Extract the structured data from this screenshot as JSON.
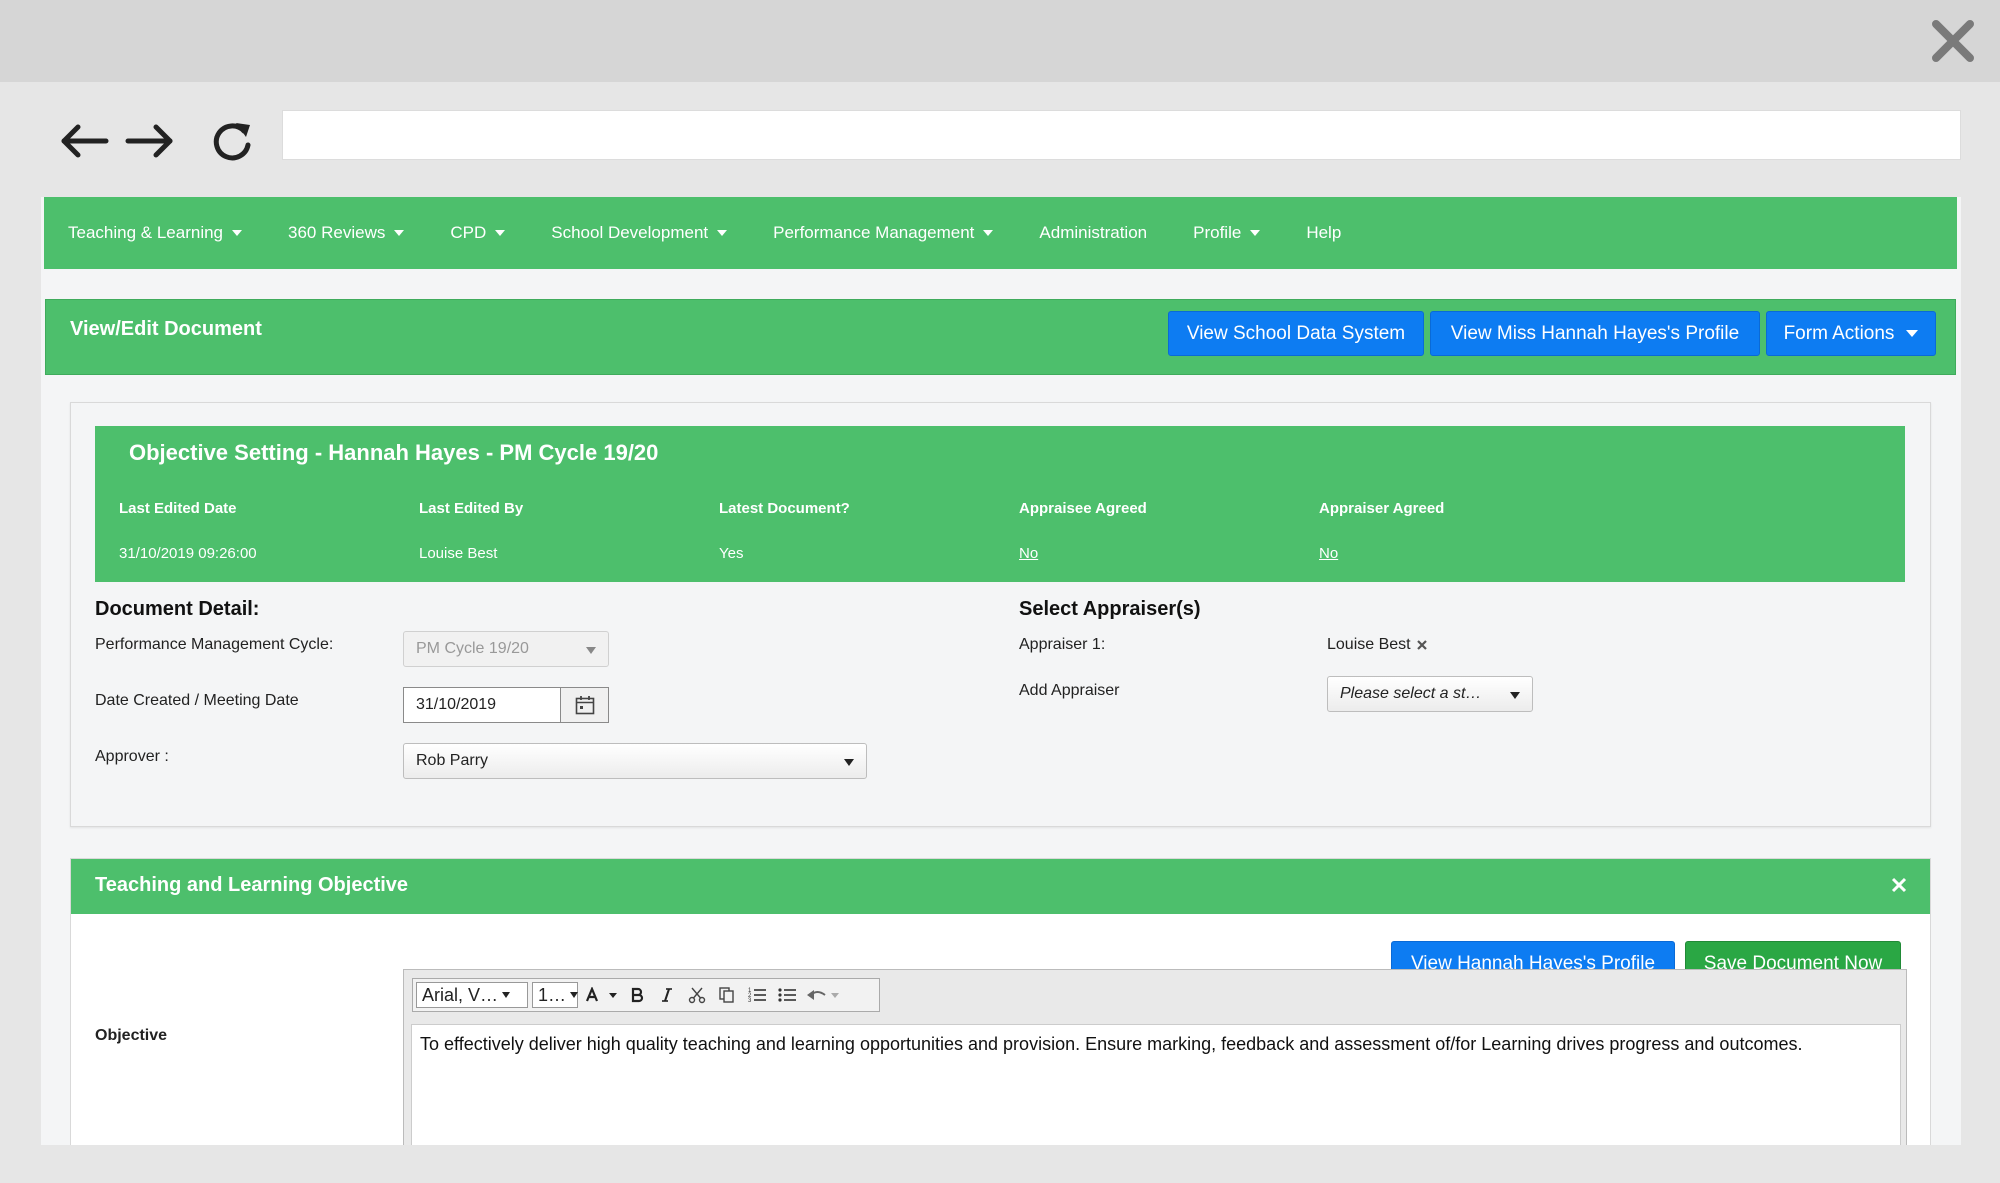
{
  "menu": {
    "items": [
      {
        "label": "Teaching & Learning",
        "caret": true
      },
      {
        "label": "360 Reviews",
        "caret": true
      },
      {
        "label": "CPD",
        "caret": true
      },
      {
        "label": "School Development",
        "caret": true
      },
      {
        "label": "Performance Management",
        "caret": true
      },
      {
        "label": "Administration",
        "caret": false
      },
      {
        "label": "Profile",
        "caret": true
      },
      {
        "label": "Help",
        "caret": false
      }
    ]
  },
  "header": {
    "title": "View/Edit Document",
    "btn_school_data": "View School Data System",
    "btn_profile": "View Miss Hannah Hayes's Profile",
    "btn_form_actions": "Form Actions"
  },
  "document": {
    "banner_title": "Objective Setting - Hannah Hayes - PM Cycle 19/20",
    "info": [
      {
        "head": "Last Edited Date",
        "value": "31/10/2019 09:26:00",
        "link": false
      },
      {
        "head": "Last Edited By",
        "value": "Louise Best",
        "link": false
      },
      {
        "head": "Latest Document?",
        "value": "Yes",
        "link": false
      },
      {
        "head": "Appraisee Agreed",
        "value": "No",
        "link": true
      },
      {
        "head": "Appraiser Agreed",
        "value": "No",
        "link": true
      }
    ],
    "detail_heading": "Document Detail:",
    "cycle_label": "Performance Management Cycle:",
    "cycle_value": "PM Cycle 19/20",
    "date_label": "Date Created / Meeting Date",
    "date_value": "31/10/2019",
    "approver_label": "Approver :",
    "approver_value": "Rob Parry",
    "appraisers_heading": "Select Appraiser(s)",
    "appraiser1_label": "Appraiser 1:",
    "appraiser1_value": "Louise Best",
    "add_appraiser_label": "Add Appraiser",
    "add_appraiser_placeholder": "Please select a st…"
  },
  "objective": {
    "panel_title": "Teaching and Learning Objective",
    "btn_view_profile": "View Hannah Hayes's Profile",
    "btn_save": "Save Document Now",
    "objective_label": "Objective",
    "font_family": "Arial, V…",
    "font_size": "1…",
    "text": "To effectively deliver high quality teaching and learning opportunities and provision.  Ensure marking, feedback and assessment of/for Learning drives progress and outcomes."
  },
  "colors": {
    "brand_green": "#4dbf6c",
    "primary_blue": "#0d7cf2",
    "success_green": "#2aa744"
  }
}
